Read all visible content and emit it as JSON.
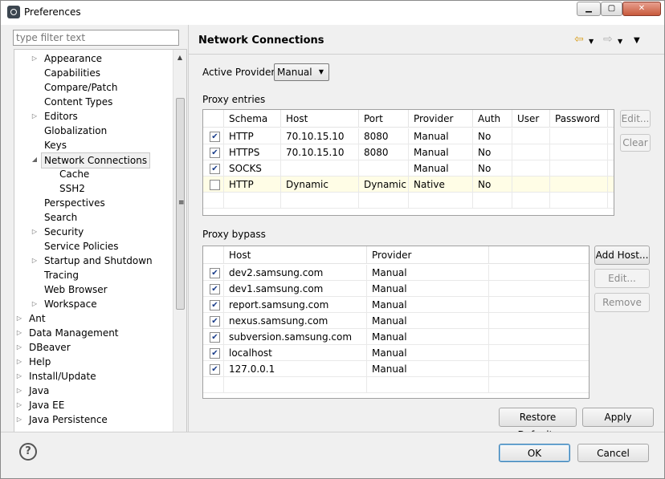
{
  "window": {
    "title": "Preferences"
  },
  "filter": {
    "placeholder": "type filter text"
  },
  "tree": {
    "items": [
      {
        "label": "Appearance",
        "level": 1,
        "expander": "closed"
      },
      {
        "label": "Capabilities",
        "level": 1,
        "expander": "none"
      },
      {
        "label": "Compare/Patch",
        "level": 1,
        "expander": "none"
      },
      {
        "label": "Content Types",
        "level": 1,
        "expander": "none"
      },
      {
        "label": "Editors",
        "level": 1,
        "expander": "closed"
      },
      {
        "label": "Globalization",
        "level": 1,
        "expander": "none"
      },
      {
        "label": "Keys",
        "level": 1,
        "expander": "none"
      },
      {
        "label": "Network Connections",
        "level": 1,
        "expander": "open",
        "selected": true
      },
      {
        "label": "Cache",
        "level": 2,
        "expander": "none"
      },
      {
        "label": "SSH2",
        "level": 2,
        "expander": "none"
      },
      {
        "label": "Perspectives",
        "level": 1,
        "expander": "none"
      },
      {
        "label": "Search",
        "level": 1,
        "expander": "none"
      },
      {
        "label": "Security",
        "level": 1,
        "expander": "closed"
      },
      {
        "label": "Service Policies",
        "level": 1,
        "expander": "none"
      },
      {
        "label": "Startup and Shutdown",
        "level": 1,
        "expander": "closed"
      },
      {
        "label": "Tracing",
        "level": 1,
        "expander": "none"
      },
      {
        "label": "Web Browser",
        "level": 1,
        "expander": "none"
      },
      {
        "label": "Workspace",
        "level": 1,
        "expander": "closed"
      },
      {
        "label": "Ant",
        "level": 0,
        "expander": "closed"
      },
      {
        "label": "Data Management",
        "level": 0,
        "expander": "closed"
      },
      {
        "label": "DBeaver",
        "level": 0,
        "expander": "closed"
      },
      {
        "label": "Help",
        "level": 0,
        "expander": "closed"
      },
      {
        "label": "Install/Update",
        "level": 0,
        "expander": "closed"
      },
      {
        "label": "Java",
        "level": 0,
        "expander": "closed"
      },
      {
        "label": "Java EE",
        "level": 0,
        "expander": "closed"
      },
      {
        "label": "Java Persistence",
        "level": 0,
        "expander": "closed"
      }
    ]
  },
  "page": {
    "title": "Network Connections"
  },
  "active_provider": {
    "label": "Active Provider:",
    "value": "Manual"
  },
  "proxy_entries": {
    "label": "Proxy entries",
    "columns": [
      "Schema",
      "Host",
      "Port",
      "Provider",
      "Auth",
      "User",
      "Password"
    ],
    "rows": [
      {
        "checked": true,
        "cells": [
          "HTTP",
          "70.10.15.10",
          "8080",
          "Manual",
          "No",
          "",
          ""
        ]
      },
      {
        "checked": true,
        "cells": [
          "HTTPS",
          "70.10.15.10",
          "8080",
          "Manual",
          "No",
          "",
          ""
        ]
      },
      {
        "checked": true,
        "cells": [
          "SOCKS",
          "",
          "",
          "Manual",
          "No",
          "",
          ""
        ]
      },
      {
        "checked": false,
        "highlight": true,
        "cells": [
          "HTTP",
          "Dynamic",
          "Dynamic",
          "Native",
          "No",
          "",
          ""
        ]
      }
    ],
    "buttons": {
      "edit": "Edit...",
      "clear": "Clear"
    }
  },
  "proxy_bypass": {
    "label": "Proxy bypass",
    "columns": [
      "Host",
      "Provider"
    ],
    "rows": [
      {
        "checked": true,
        "cells": [
          "dev2.samsung.com",
          "Manual"
        ]
      },
      {
        "checked": true,
        "cells": [
          "dev1.samsung.com",
          "Manual"
        ]
      },
      {
        "checked": true,
        "cells": [
          "report.samsung.com",
          "Manual"
        ]
      },
      {
        "checked": true,
        "cells": [
          "nexus.samsung.com",
          "Manual"
        ]
      },
      {
        "checked": true,
        "cells": [
          "subversion.samsung.com",
          "Manual"
        ]
      },
      {
        "checked": true,
        "cells": [
          "localhost",
          "Manual"
        ]
      },
      {
        "checked": true,
        "cells": [
          "127.0.0.1",
          "Manual"
        ]
      }
    ],
    "buttons": {
      "add": "Add Host...",
      "edit": "Edit...",
      "remove": "Remove"
    }
  },
  "page_buttons": {
    "restore": "Restore Defaults",
    "apply": "Apply"
  },
  "dialog_buttons": {
    "ok": "OK",
    "cancel": "Cancel"
  },
  "icons": {
    "check": "✔",
    "help": "?"
  },
  "colors": {
    "highlight_row": "#fffde6",
    "selection_border": "#c8c8c8"
  }
}
